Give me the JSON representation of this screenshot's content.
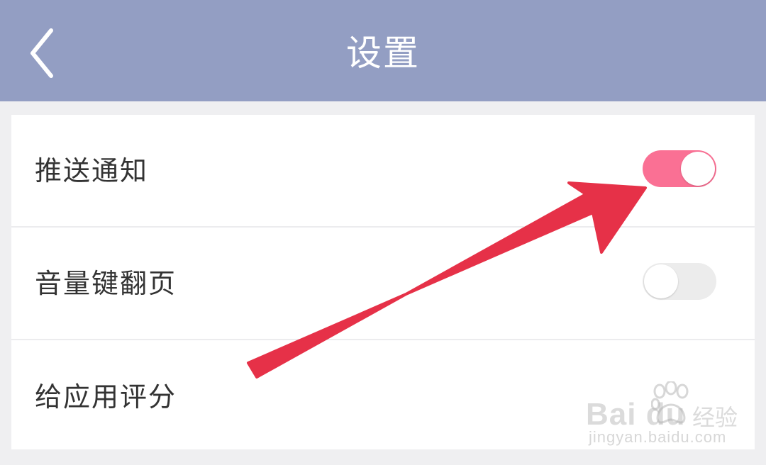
{
  "header": {
    "title": "设置",
    "back_icon": "chevron-left-icon"
  },
  "settings": [
    {
      "label": "推送通知",
      "toggle": true
    },
    {
      "label": "音量键翻页",
      "toggle": false
    },
    {
      "label": "给应用评分"
    }
  ],
  "watermark": {
    "brand": "Bai  du",
    "chinese": "经验",
    "url": "jingyan.baidu.com"
  },
  "colors": {
    "header_bg": "#939ec3",
    "toggle_on": "#fa7094",
    "toggle_off": "#ececec",
    "arrow": "#e63148",
    "page_bg": "#efeff1"
  }
}
